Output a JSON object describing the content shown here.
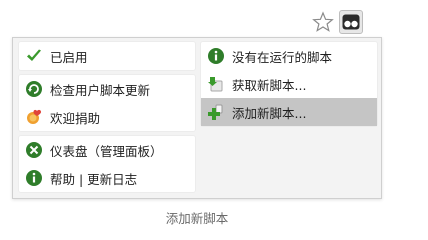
{
  "popup": {
    "left_groups": [
      {
        "items": [
          {
            "label": "已启用",
            "icon": "check-icon"
          }
        ]
      },
      {
        "items": [
          {
            "label": "检查用户脚本更新",
            "icon": "refresh-icon"
          },
          {
            "label": "欢迎捐助",
            "icon": "donate-icon"
          }
        ]
      },
      {
        "items": [
          {
            "label": "仪表盘（管理面板）",
            "icon": "dashboard-icon"
          },
          {
            "label": "帮助 | 更新日志",
            "icon": "info-icon"
          }
        ]
      }
    ],
    "right_items": [
      {
        "label": "没有在运行的脚本",
        "icon": "info-icon"
      },
      {
        "label": "获取新脚本...",
        "icon": "get-scripts-icon"
      },
      {
        "label": "添加新脚本...",
        "icon": "add-icon",
        "highlighted": true
      }
    ]
  },
  "caption": "添加新脚本",
  "colors": {
    "green": "#3a8f2a",
    "highlight": "#c5c5c5"
  }
}
